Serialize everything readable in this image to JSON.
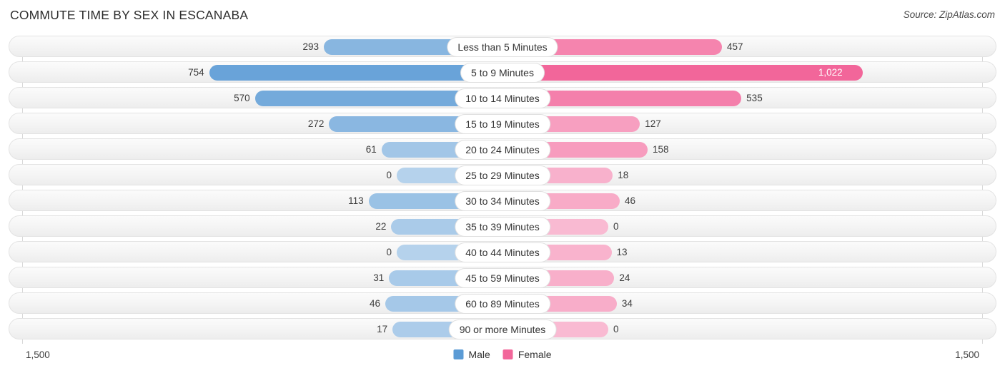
{
  "header": {
    "title": "COMMUTE TIME BY SEX IN ESCANABA",
    "source": "Source: ZipAtlas.com"
  },
  "legend": {
    "male": {
      "label": "Male",
      "color": "#5b9bd5"
    },
    "female": {
      "label": "Female",
      "color": "#f2669a"
    }
  },
  "axis": {
    "left_label": "1,500",
    "right_label": "1,500"
  },
  "chart_data": {
    "type": "bar",
    "title": "COMMUTE TIME BY SEX IN ESCANABA",
    "subtitle": "Source: ZipAtlas.com",
    "orientation": "horizontal-diverging",
    "xlabel": "",
    "ylabel": "",
    "xlim": [
      -1500,
      1500
    ],
    "axis_end_labels": [
      "1,500",
      "1,500"
    ],
    "grid": true,
    "legend_position": "bottom-center",
    "categories": [
      "Less than 5 Minutes",
      "5 to 9 Minutes",
      "10 to 14 Minutes",
      "15 to 19 Minutes",
      "20 to 24 Minutes",
      "25 to 29 Minutes",
      "30 to 34 Minutes",
      "35 to 39 Minutes",
      "40 to 44 Minutes",
      "45 to 59 Minutes",
      "60 to 89 Minutes",
      "90 or more Minutes"
    ],
    "series": [
      {
        "name": "Male",
        "color": "#5b9bd5",
        "values": [
          293,
          754,
          570,
          272,
          61,
          0,
          113,
          22,
          0,
          31,
          46,
          17
        ],
        "labels": [
          "293",
          "754",
          "570",
          "272",
          "61",
          "0",
          "113",
          "22",
          "0",
          "31",
          "46",
          "17"
        ]
      },
      {
        "name": "Female",
        "color": "#f2669a",
        "values": [
          457,
          1022,
          535,
          127,
          158,
          18,
          46,
          0,
          13,
          24,
          34,
          0
        ],
        "labels": [
          "457",
          "1,022",
          "535",
          "127",
          "158",
          "18",
          "46",
          "0",
          "13",
          "24",
          "34",
          "0"
        ]
      }
    ],
    "rows": [
      {
        "category": "Less than 5 Minutes",
        "male": 293,
        "male_label": "293",
        "female": 457,
        "female_label": "457"
      },
      {
        "category": "5 to 9 Minutes",
        "male": 754,
        "male_label": "754",
        "female": 1022,
        "female_label": "1,022"
      },
      {
        "category": "10 to 14 Minutes",
        "male": 570,
        "male_label": "570",
        "female": 535,
        "female_label": "535"
      },
      {
        "category": "15 to 19 Minutes",
        "male": 272,
        "male_label": "272",
        "female": 127,
        "female_label": "127"
      },
      {
        "category": "20 to 24 Minutes",
        "male": 61,
        "male_label": "61",
        "female": 158,
        "female_label": "158"
      },
      {
        "category": "25 to 29 Minutes",
        "male": 0,
        "male_label": "0",
        "female": 18,
        "female_label": "18"
      },
      {
        "category": "30 to 34 Minutes",
        "male": 113,
        "male_label": "113",
        "female": 46,
        "female_label": "46"
      },
      {
        "category": "35 to 39 Minutes",
        "male": 22,
        "male_label": "22",
        "female": 0,
        "female_label": "0"
      },
      {
        "category": "40 to 44 Minutes",
        "male": 0,
        "male_label": "0",
        "female": 13,
        "female_label": "13"
      },
      {
        "category": "45 to 59 Minutes",
        "male": 31,
        "male_label": "31",
        "female": 24,
        "female_label": "24"
      },
      {
        "category": "60 to 89 Minutes",
        "male": 46,
        "male_label": "46",
        "female": 34,
        "female_label": "34"
      },
      {
        "category": "90 or more Minutes",
        "male": 17,
        "male_label": "17",
        "female": 0,
        "female_label": "0"
      }
    ]
  }
}
